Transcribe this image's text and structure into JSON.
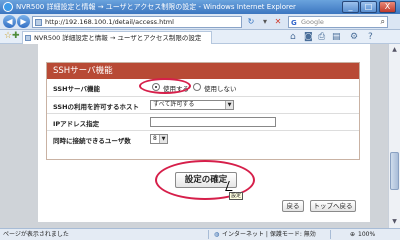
{
  "window": {
    "title": "NVR500 詳細設定と情報 → ユーザとアクセス制限の設定 - Windows Internet Explorer",
    "minimize": "_",
    "maximize": "□",
    "close": "X"
  },
  "address_bar": {
    "url": "http://192.168.100.1/detail/access.html",
    "search_placeholder": "Google"
  },
  "tab": {
    "title": "NVR500 詳細設定と情報 → ユーザとアクセス制限の設定"
  },
  "panel": {
    "header": "SSHサーバ機能",
    "rows": [
      {
        "label": "SSHサーバ機能",
        "options": [
          "使用する",
          "使用しない"
        ],
        "selected": "使用する"
      },
      {
        "label": "SSHの利用を許可するホスト",
        "value": "すべて許可する"
      },
      {
        "label": "IPアドレス指定",
        "value": ""
      },
      {
        "label": "同時に接続できるユーザ数",
        "value": "8"
      }
    ]
  },
  "buttons": {
    "apply": "設定の確定",
    "back": "戻る",
    "top": "トップへ戻る"
  },
  "tooltip": "設定",
  "status": {
    "left": "ページが表示されました",
    "zone": "インターネット | 保護モード: 無効",
    "zoom": "100%"
  },
  "colors": {
    "panel_header": "#b84a35",
    "highlight": "#d61f4a",
    "title_bar": "#3c76c0"
  }
}
